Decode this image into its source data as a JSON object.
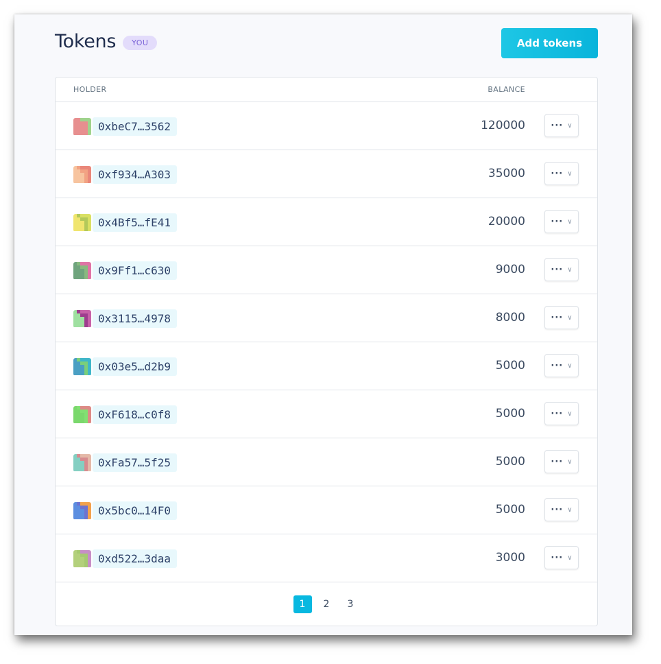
{
  "header": {
    "title": "Tokens",
    "badge": "YOU",
    "add_button_label": "Add tokens"
  },
  "table": {
    "columns": {
      "holder": "HOLDER",
      "balance": "BALANCE"
    },
    "rows": [
      {
        "address": "0xbeC7…3562",
        "balance": "120000",
        "avatar_colors": [
          "#e78f8f",
          "#9fd38c",
          "#e78f8f"
        ]
      },
      {
        "address": "0xf934…A303",
        "balance": "35000",
        "avatar_colors": [
          "#f2a283",
          "#f7c49f",
          "#e9877a"
        ]
      },
      {
        "address": "0x4Bf5…fE41",
        "balance": "20000",
        "avatar_colors": [
          "#d9e063",
          "#b3c95a",
          "#f0e56f"
        ]
      },
      {
        "address": "0x9Ff1…c630",
        "balance": "9000",
        "avatar_colors": [
          "#6fa47d",
          "#e073a6",
          "#89b97f"
        ]
      },
      {
        "address": "0x3115…4978",
        "balance": "8000",
        "avatar_colors": [
          "#9e3d8e",
          "#9fe0a0",
          "#c761a8"
        ]
      },
      {
        "address": "0x03e5…d2b9",
        "balance": "5000",
        "avatar_colors": [
          "#3fb6c9",
          "#7acf7b",
          "#4a9fc3"
        ]
      },
      {
        "address": "0xF618…c0f8",
        "balance": "5000",
        "avatar_colors": [
          "#7ad86c",
          "#dd8a86",
          "#82df72"
        ]
      },
      {
        "address": "0xFa57…5f25",
        "balance": "5000",
        "avatar_colors": [
          "#d78b8f",
          "#84cfc2",
          "#e4b9a8"
        ]
      },
      {
        "address": "0x5bc0…14F0",
        "balance": "5000",
        "avatar_colors": [
          "#f2a24c",
          "#6e73cf",
          "#5c8ee0"
        ]
      },
      {
        "address": "0xd522…3daa",
        "balance": "3000",
        "avatar_colors": [
          "#b3d07b",
          "#c78ec6",
          "#a6c971"
        ]
      }
    ]
  },
  "pagination": {
    "pages": [
      "1",
      "2",
      "3"
    ],
    "active": "1"
  },
  "colors": {
    "accent": "#08b8e0",
    "badge_bg": "#e3dcfb",
    "badge_text": "#7a62d8"
  }
}
